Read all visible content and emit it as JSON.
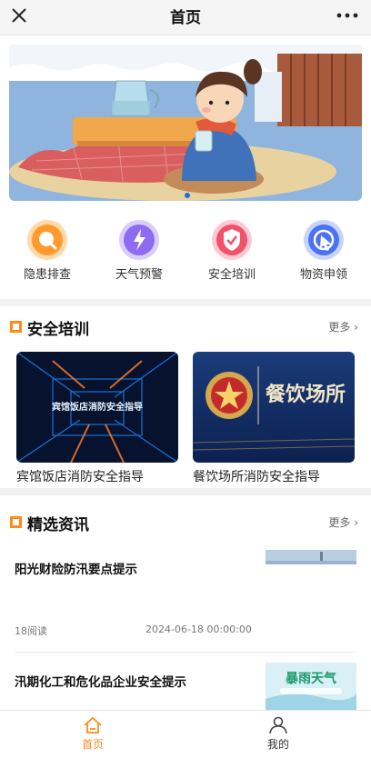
{
  "topbar": {
    "title": "首页",
    "close_icon": "close-icon",
    "more_icon": "more-dots-icon"
  },
  "banner": {
    "active_slide": 1,
    "slide_count": 1
  },
  "quick_actions": [
    {
      "label": "隐患排查",
      "icon": "search-badge-icon",
      "color": "#ff9a2e"
    },
    {
      "label": "天气预警",
      "icon": "lightning-badge-icon",
      "color": "#8d6bf2"
    },
    {
      "label": "安全培训",
      "icon": "shield-check-icon",
      "color": "#f2516a"
    },
    {
      "label": "物资申领",
      "icon": "cursor-badge-icon",
      "color": "#4a72f2"
    }
  ],
  "training": {
    "title": "安全培训",
    "more": "更多",
    "cards": [
      {
        "title": "宾馆饭店消防安全指导",
        "thumb_text": "宾馆饭店消防安全指导"
      },
      {
        "title": "餐饮场所消防安全指导",
        "thumb_text": "餐饮场所"
      }
    ]
  },
  "news": {
    "title": "精选资讯",
    "more": "更多",
    "items": [
      {
        "title": "阳光财险防汛要点提示",
        "reads": "18阅读",
        "date": "2024-06-18 00:00:00"
      },
      {
        "title": "汛期化工和危化品企业安全提示",
        "thumb_text": "暴雨天气"
      }
    ]
  },
  "tabbar": {
    "items": [
      {
        "label": "首页",
        "icon": "home-icon",
        "active": true
      },
      {
        "label": "我的",
        "icon": "user-icon",
        "active": false
      }
    ],
    "active_color": "#ff8a1c"
  }
}
